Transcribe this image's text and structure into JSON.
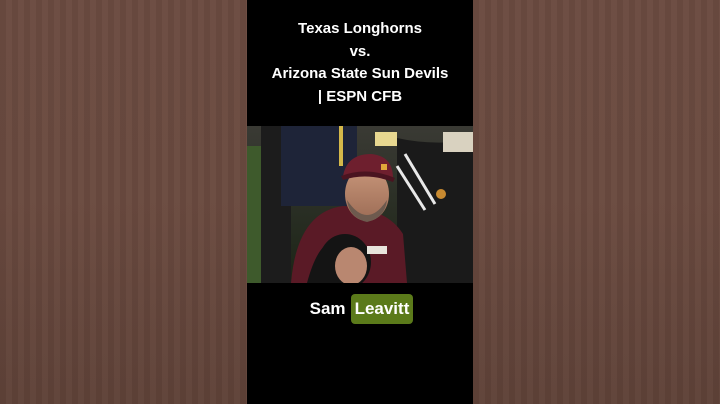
{
  "video": {
    "title_lines": [
      "Texas Longhorns",
      "vs.",
      "Arizona State Sun Devils",
      "| ESPN CFB"
    ]
  },
  "caption": {
    "word1": "Sam",
    "word2": "Leavitt",
    "highlight_color": "#5b7a1a"
  },
  "colors": {
    "background_blur": "#6b4b40",
    "frame": "#000000",
    "text": "#ffffff"
  }
}
